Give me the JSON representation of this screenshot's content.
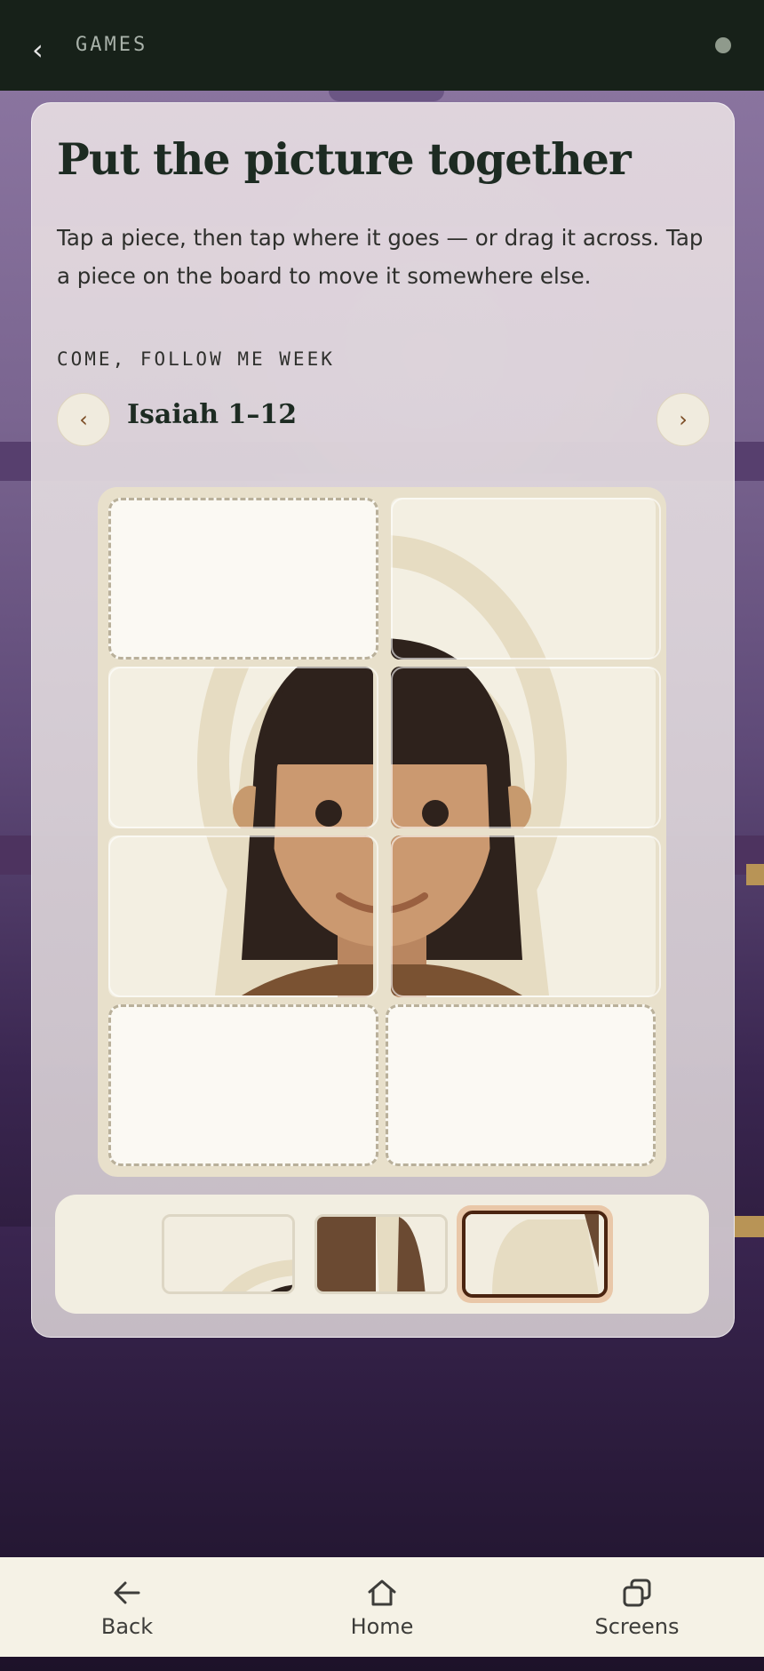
{
  "topbar": {
    "back_glyph": "‹",
    "title": "GAMES"
  },
  "card": {
    "title": "Put the picture together",
    "description": "Tap a piece, then tap where it goes — or drag it across. Tap a piece on the board to move it somewhere else.",
    "week_label": "COME, FOLLOW ME WEEK",
    "week_name": "Isaiah 1–12",
    "prev_glyph": "‹",
    "next_glyph": "›"
  },
  "puzzle": {
    "grid": {
      "rows": 4,
      "cols": 2
    },
    "slots": [
      {
        "row": 1,
        "col": 1,
        "state": "empty"
      },
      {
        "row": 1,
        "col": 2,
        "state": "placed"
      },
      {
        "row": 2,
        "col": 1,
        "state": "placed"
      },
      {
        "row": 2,
        "col": 2,
        "state": "placed"
      },
      {
        "row": 3,
        "col": 1,
        "state": "placed"
      },
      {
        "row": 3,
        "col": 2,
        "state": "placed"
      },
      {
        "row": 4,
        "col": 1,
        "state": "empty"
      },
      {
        "row": 4,
        "col": 2,
        "state": "empty"
      }
    ],
    "tray_pieces": [
      {
        "state": "idle"
      },
      {
        "state": "idle"
      },
      {
        "state": "selected"
      }
    ]
  },
  "bottom_nav": {
    "items": [
      {
        "label": "Back",
        "icon": "arrow-left-icon"
      },
      {
        "label": "Home",
        "icon": "home-icon"
      },
      {
        "label": "Screens",
        "icon": "screens-icon"
      }
    ]
  },
  "colors": {
    "topbar": "#172119",
    "accent_brown": "#7a4a22",
    "selected_outline": "#4a2410",
    "cream": "#f2eee1"
  }
}
